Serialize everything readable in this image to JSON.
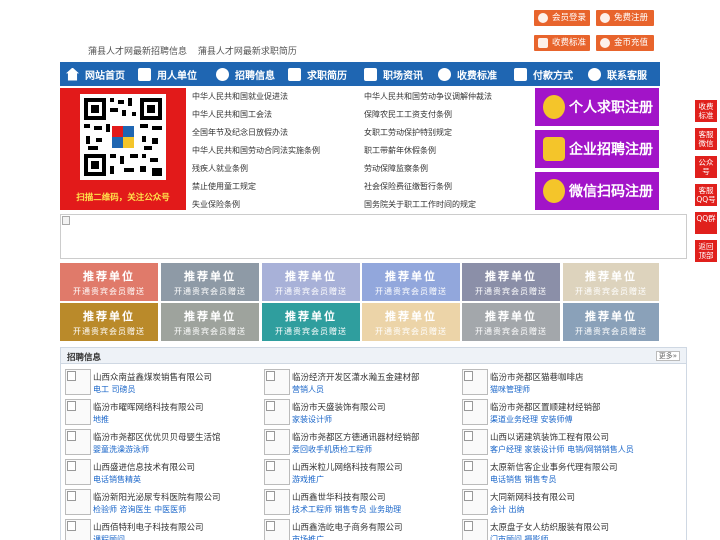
{
  "header": {
    "links": [
      "蒲县人才网最新招聘信息",
      "蒲县人才网最新求职简历"
    ],
    "buttons": [
      {
        "label": "会员登录",
        "icon": "user-icon"
      },
      {
        "label": "免费注册",
        "icon": "user-add-icon"
      },
      {
        "label": "收费标准",
        "icon": "yen-icon"
      },
      {
        "label": "金币充值",
        "icon": "coin-icon"
      }
    ]
  },
  "nav": [
    {
      "label": "网站首页",
      "icon": "home-icon"
    },
    {
      "label": "用人单位",
      "icon": "building-icon"
    },
    {
      "label": "招聘信息",
      "icon": "megaphone-icon"
    },
    {
      "label": "求职简历",
      "icon": "resume-icon"
    },
    {
      "label": "职场资讯",
      "icon": "news-icon"
    },
    {
      "label": "收费标准",
      "icon": "yen-icon"
    },
    {
      "label": "付款方式",
      "icon": "card-icon"
    },
    {
      "label": "联系客服",
      "icon": "phone-icon"
    }
  ],
  "qr": {
    "caption": "扫描二维码，关注公众号"
  },
  "laws": {
    "left": [
      "中华人民共和国就业促进法",
      "中华人民共和国工会法",
      "全国年节及纪念日放假办法",
      "中华人民共和国劳动合同法实施条例",
      "残疾人就业条例",
      "禁止使用童工规定",
      "失业保险条例"
    ],
    "right": [
      "中华人民共和国劳动争议调解仲裁法",
      "保障农民工工资支付条例",
      "女职工劳动保护特别规定",
      "职工带薪年休假条例",
      "劳动保障监察条例",
      "社会保险费征缴暂行条例",
      "国务院关于职工工作时间的规定"
    ]
  },
  "register": [
    {
      "label": "个人求职注册",
      "icon": "person-icon"
    },
    {
      "label": "企业招聘注册",
      "icon": "company-icon"
    },
    {
      "label": "微信扫码注册",
      "icon": "wechat-icon"
    }
  ],
  "side": [
    "收费标准",
    "客服微信",
    "公众号",
    "客服QQ号",
    "QQ群",
    "返回顶部"
  ],
  "recommend": {
    "title": "推荐单位",
    "sub": "开通贵宾会员赠送",
    "colors": [
      [
        "#e07a6a",
        "#8e9aa6",
        "#a8b1d8",
        "#92a7dc",
        "#8b8fa8",
        "#ddd3bd"
      ],
      [
        "#ba8a2a",
        "#9ea39d",
        "#2f9e9e",
        "#ecd4a8",
        "#a3a7ab",
        "#8aa1b9"
      ]
    ]
  },
  "jobs": {
    "title": "招聘信息",
    "more": "更多»",
    "items": [
      {
        "company": "山西众南益鑫煤炭销售有限公司",
        "positions": "电工 司磅员"
      },
      {
        "company": "临汾经济开发区潇水瀚五金建材部",
        "positions": "营销人员"
      },
      {
        "company": "临汾市尧都区猫巷咖啡店",
        "positions": "猫咪管理师"
      },
      {
        "company": "临汾市曜晖网络科技有限公司",
        "positions": "地推"
      },
      {
        "company": "临汾市天盛装饰有限公司",
        "positions": "家装设计师"
      },
      {
        "company": "临汾市尧都区置顺建材经销部",
        "positions": "渠道业务经理 安装师傅"
      },
      {
        "company": "临汾市尧都区优优贝贝母婴生活馆",
        "positions": "婴童洗澡游泳师"
      },
      {
        "company": "临汾市尧都区方德通讯器材经销部",
        "positions": "爱回收手机质检工程师"
      },
      {
        "company": "山西以诺建筑装饰工程有限公司",
        "positions": "客户经理 家装设计师 电销/网销销售人员"
      },
      {
        "company": "山西盛进信息技术有限公司",
        "positions": "电话销售精英"
      },
      {
        "company": "山西米粒儿网络科技有限公司",
        "positions": "游戏推广"
      },
      {
        "company": "太原新信客企业事务代理有限公司",
        "positions": "电话销售 销售专员"
      },
      {
        "company": "临汾新阳光泌尿专科医院有限公司",
        "positions": "检验师 咨询医生 中医医师"
      },
      {
        "company": "山西鑫世华科技有限公司",
        "positions": "技术工程师 销售专员 业务助理"
      },
      {
        "company": "大同新网科技有限公司",
        "positions": "会计 出纳"
      },
      {
        "company": "山西佰特利电子科技有限公司",
        "positions": "课程顾问"
      },
      {
        "company": "山西鑫浩屹电子商务有限公司",
        "positions": "市场推广"
      },
      {
        "company": "太原盘子女人纺织服装有限公司",
        "positions": "门市顾问 摄影师"
      }
    ]
  },
  "colors": {
    "nav": "#1f66b2",
    "accent": "#e8642c",
    "register": "#a214c8",
    "side": "#e0201c",
    "qr": "#e21a1a"
  }
}
